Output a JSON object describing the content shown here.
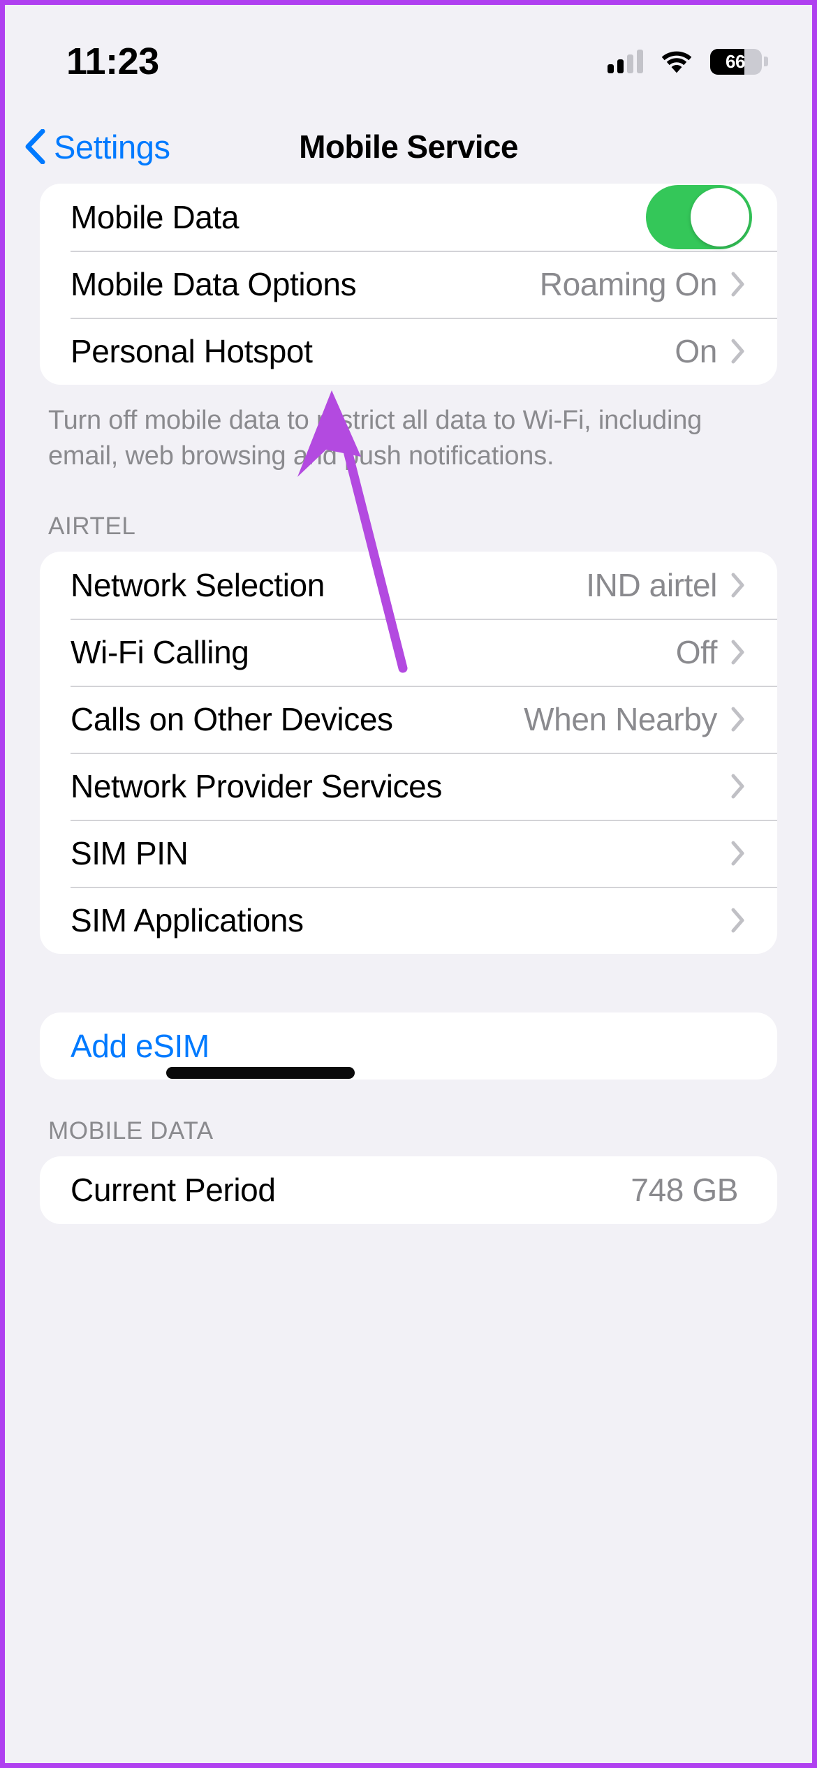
{
  "status_bar": {
    "time": "11:23",
    "cellular_icon": "cellular-signal-icon",
    "cellular_bars_filled": 2,
    "cellular_bars_total": 4,
    "wifi_icon": "wifi-icon",
    "battery_icon": "battery-icon",
    "battery_percent": "66"
  },
  "nav": {
    "back_label": "Settings",
    "back_icon": "chevron-left-icon",
    "title": "Mobile Service"
  },
  "sections": {
    "data_group": {
      "rows": [
        {
          "label": "Mobile Data",
          "value": "",
          "control": "toggle",
          "toggle_on": true
        },
        {
          "label": "Mobile Data Options",
          "value": "Roaming On",
          "control": "chevron"
        },
        {
          "label": "Personal Hotspot",
          "value": "On",
          "control": "chevron"
        }
      ],
      "footer": "Turn off mobile data to restrict all data to Wi-Fi, including email, web browsing and push notifications."
    },
    "carrier_group": {
      "header": "AIRTEL",
      "rows": [
        {
          "label": "Network Selection",
          "value": "IND airtel",
          "control": "chevron"
        },
        {
          "label": "Wi-Fi Calling",
          "value": "Off",
          "control": "chevron"
        },
        {
          "label": "Calls on Other Devices",
          "value": "When Nearby",
          "control": "chevron"
        },
        {
          "label": "Network Provider Services",
          "value": "",
          "control": "chevron"
        },
        {
          "label": "SIM PIN",
          "value": "",
          "control": "chevron"
        },
        {
          "label": "SIM Applications",
          "value": "",
          "control": "chevron"
        }
      ]
    },
    "esim_group": {
      "rows": [
        {
          "label": "Add eSIM",
          "value": "",
          "control": "none"
        }
      ]
    },
    "mobile_data_group": {
      "header": "MOBILE DATA",
      "rows": [
        {
          "label": "Current Period",
          "value": "748 GB",
          "control": "none"
        }
      ]
    }
  },
  "annotation": {
    "arrow_color": "#b34ae0",
    "arrow_target": "Mobile Data Options"
  },
  "colors": {
    "accent_blue": "#007aff",
    "toggle_green": "#34c759",
    "background": "#f2f1f6",
    "card": "#ffffff",
    "secondary_text": "#8a8a8e",
    "frame_purple": "#b040f0"
  }
}
